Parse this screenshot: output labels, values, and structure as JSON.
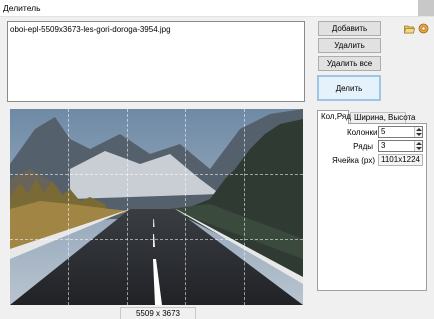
{
  "window": {
    "title": "Делитель"
  },
  "file_list": {
    "items": [
      "oboi-epl-5509x3673-les-gori-doroga-3954.jpg"
    ]
  },
  "buttons": {
    "add": "Добавить",
    "delete": "Удалить",
    "delete_all": "Удалить все",
    "split": "Делить"
  },
  "icons": {
    "open": "folder-icon",
    "settings": "settings-icon"
  },
  "preview": {
    "image_size": "5509 x 3673"
  },
  "tabs": [
    "Кол,Ряд",
    "Ширина, Высота"
  ],
  "settings": {
    "columns_label": "Колонки",
    "columns_value": "5",
    "rows_label": "Ряды",
    "rows_value": "3",
    "cell_label": "Ячейка (px)",
    "cell_value": "1101x1224"
  }
}
